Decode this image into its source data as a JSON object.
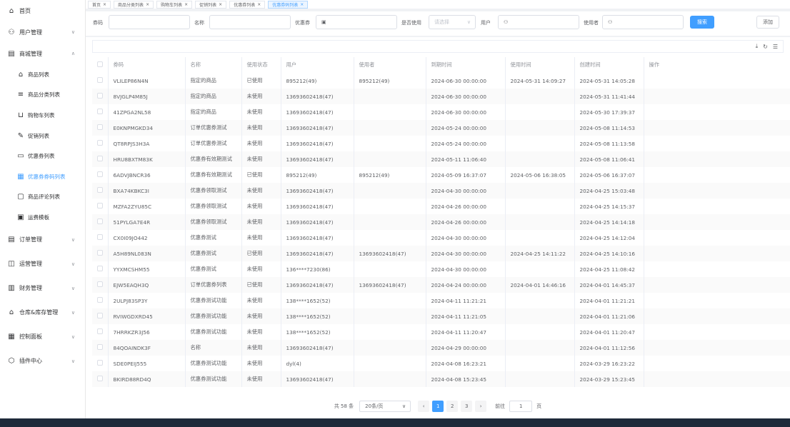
{
  "sidebar": {
    "home": "首页",
    "user_mgmt": "用户管理",
    "mall_mgmt": "商城管理",
    "mall_items": [
      {
        "label": "商品列表",
        "icon": "bag-icon"
      },
      {
        "label": "商品分类列表",
        "icon": "category-icon"
      },
      {
        "label": "购物车列表",
        "icon": "cart-icon"
      },
      {
        "label": "促销列表",
        "icon": "promo-icon"
      },
      {
        "label": "优惠券列表",
        "icon": "coupon-icon"
      },
      {
        "label": "优惠券券码列表",
        "icon": "coupon-code-icon"
      },
      {
        "label": "商品评论列表",
        "icon": "comment-icon"
      },
      {
        "label": "运费模板",
        "icon": "freight-icon"
      }
    ],
    "menus": [
      {
        "label": "订单管理",
        "icon": "order-icon"
      },
      {
        "label": "运营管理",
        "icon": "ops-icon"
      },
      {
        "label": "财务管理",
        "icon": "finance-icon"
      },
      {
        "label": "仓库&库存管理",
        "icon": "warehouse-icon"
      },
      {
        "label": "控制面板",
        "icon": "dashboard-icon"
      },
      {
        "label": "插件中心",
        "icon": "plugin-icon"
      }
    ]
  },
  "tabs": [
    "首页",
    "商品分类列表",
    "购物车列表",
    "促销列表",
    "优惠券列表",
    "优惠券码列表"
  ],
  "search": {
    "code_label": "券码",
    "name_label": "名称",
    "coupon_label": "优惠券",
    "used_label": "是否使用",
    "used_placeholder": "请选择",
    "user_label": "用户",
    "user_by_label": "使用者",
    "search_btn": "搜索",
    "add_btn": "添加"
  },
  "table": {
    "headers": [
      "券码",
      "名称",
      "使用状态",
      "用户",
      "使用者",
      "到期时间",
      "使用时间",
      "创建时间",
      "操作"
    ],
    "rows": [
      [
        "VLILEP86N4N",
        "指定的商品",
        "已使用",
        "895212(49)",
        "895212(49)",
        "2024-06-30 00:00:00",
        "2024-05-31 14:09:27",
        "2024-05-31 14:05:28",
        ""
      ],
      [
        "8VJGLP4M85J",
        "指定的商品",
        "未使用",
        "13693602418(47)",
        "",
        "2024-06-30 00:00:00",
        "",
        "2024-05-31 11:41:44",
        ""
      ],
      [
        "41ZPGA2NL58",
        "指定的商品",
        "未使用",
        "13693602418(47)",
        "",
        "2024-06-30 00:00:00",
        "",
        "2024-05-30 17:39:37",
        ""
      ],
      [
        "E0KNPMGKD34",
        "订单优惠券测试",
        "未使用",
        "13693602418(47)",
        "",
        "2024-05-24 00:00:00",
        "",
        "2024-05-08 11:14:53",
        ""
      ],
      [
        "QT8RPJS3H3A",
        "订单优惠券测试",
        "未使用",
        "13693602418(47)",
        "",
        "2024-05-24 00:00:00",
        "",
        "2024-05-08 11:13:58",
        ""
      ],
      [
        "HRU8BXTM83K",
        "优惠券有效期测试",
        "未使用",
        "13693602418(47)",
        "",
        "2024-05-11 11:06:40",
        "",
        "2024-05-08 11:06:41",
        ""
      ],
      [
        "6ADVJBNCR36",
        "优惠券有效期测试",
        "已使用",
        "895212(49)",
        "895212(49)",
        "2024-05-09 16:37:07",
        "2024-05-06 16:38:05",
        "2024-05-06 16:37:07",
        ""
      ],
      [
        "BXA74KBKC3I",
        "优惠券领取测试",
        "未使用",
        "13693602418(47)",
        "",
        "2024-04-30 00:00:00",
        "",
        "2024-04-25 15:03:48",
        ""
      ],
      [
        "MZFA2ZYU85C",
        "优惠券领取测试",
        "未使用",
        "13693602418(47)",
        "",
        "2024-04-26 00:00:00",
        "",
        "2024-04-25 14:15:37",
        ""
      ],
      [
        "51PYLGA7E4R",
        "优惠券领取测试",
        "未使用",
        "13693602418(47)",
        "",
        "2024-04-26 00:00:00",
        "",
        "2024-04-25 14:14:18",
        ""
      ],
      [
        "CX0I09JO442",
        "优惠券测试",
        "未使用",
        "13693602418(47)",
        "",
        "2024-04-30 00:00:00",
        "",
        "2024-04-25 14:12:04",
        ""
      ],
      [
        "A5H89NL083N",
        "优惠券测试",
        "已使用",
        "13693602418(47)",
        "13693602418(47)",
        "2024-04-30 00:00:00",
        "2024-04-25 14:11:22",
        "2024-04-25 14:10:16",
        ""
      ],
      [
        "YYXMCSHM55",
        "优惠券测试",
        "未使用",
        "136****7230(86)",
        "",
        "2024-04-30 00:00:00",
        "",
        "2024-04-25 11:08:42",
        ""
      ],
      [
        "EJW5EAQH3Q",
        "订单优惠券列表",
        "已使用",
        "13693602418(47)",
        "13693602418(47)",
        "2024-04-24 00:00:00",
        "2024-04-01 14:46:16",
        "2024-04-01 14:45:37",
        ""
      ],
      [
        "2ULPJ83SP3Y",
        "优惠券测试功能",
        "未使用",
        "138****1652(52)",
        "",
        "2024-04-11 11:21:21",
        "",
        "2024-04-01 11:21:21",
        ""
      ],
      [
        "RVIWGDXRD45",
        "优惠券测试功能",
        "未使用",
        "138****1652(52)",
        "",
        "2024-04-11 11:21:05",
        "",
        "2024-04-01 11:21:06",
        ""
      ],
      [
        "7HRRKZR3J56",
        "优惠券测试功能",
        "未使用",
        "138****1652(52)",
        "",
        "2024-04-11 11:20:47",
        "",
        "2024-04-01 11:20:47",
        ""
      ],
      [
        "84QOAINDK3F",
        "名称",
        "未使用",
        "13693602418(47)",
        "",
        "2024-04-29 00:00:00",
        "",
        "2024-04-01 11:12:56",
        ""
      ],
      [
        "SDE0PEIJ555",
        "优惠券测试功能",
        "未使用",
        "dyl(4)",
        "",
        "2024-04-08 16:23:21",
        "",
        "2024-03-29 16:23:22",
        ""
      ],
      [
        "BKIRD88RD4Q",
        "优惠券测试功能",
        "未使用",
        "13693602418(47)",
        "",
        "2024-04-08 15:23:45",
        "",
        "2024-03-29 15:23:45",
        ""
      ]
    ]
  },
  "pager": {
    "total": "共 58 条",
    "page_size": "20条/页",
    "pages": [
      "1",
      "2",
      "3"
    ],
    "prev": "‹",
    "next": "›",
    "goto_label": "前往",
    "goto_value": "1",
    "goto_suffix": "页"
  },
  "colors": {
    "accent": "#409eff",
    "sidebar_bg": "#ffffff",
    "page_bg": "#f0f2f5"
  }
}
